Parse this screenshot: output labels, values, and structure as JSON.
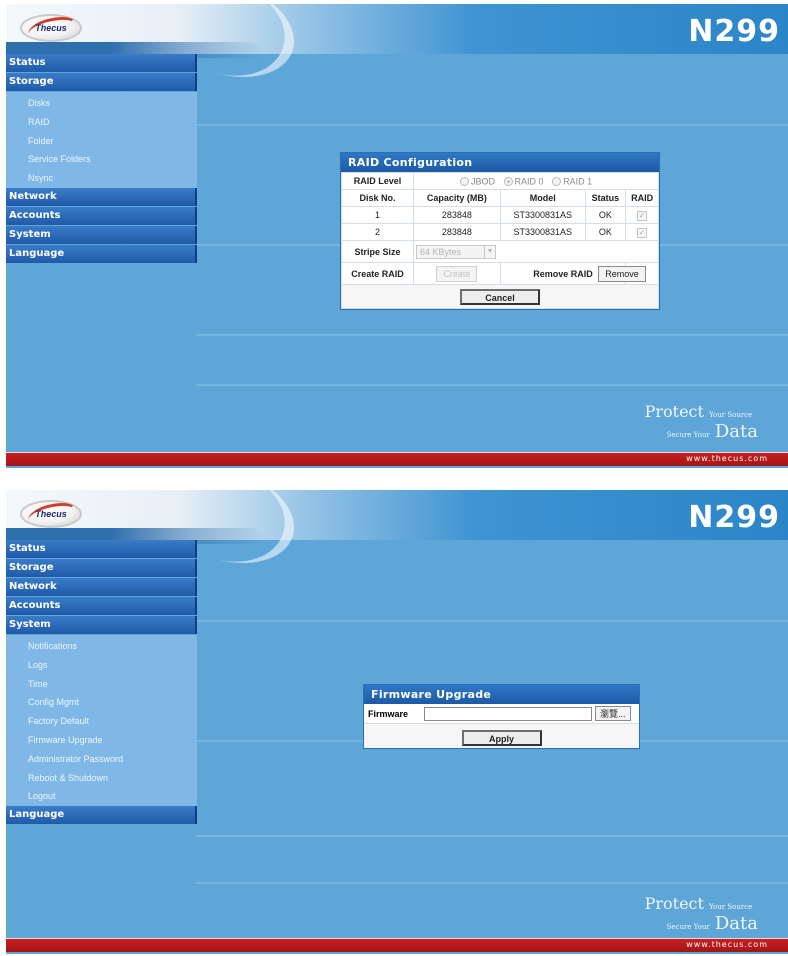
{
  "screens": [
    {
      "header": {
        "logo_text": "Thecus",
        "model": "N299"
      },
      "nav": {
        "status": "Status",
        "storage": "Storage",
        "storage_items": [
          "Disks",
          "RAID",
          "Folder",
          "Service Folders",
          "Nsync"
        ],
        "network": "Network",
        "accounts": "Accounts",
        "system": "System",
        "language": "Language"
      },
      "raid_panel": {
        "title": "RAID Configuration",
        "raid_level_label": "RAID Level",
        "options": [
          "JBOD",
          "RAID 0",
          "RAID 1"
        ],
        "selected_option": "RAID 0",
        "columns": [
          "Disk No.",
          "Capacity (MB)",
          "Model",
          "Status",
          "RAID"
        ],
        "rows": [
          {
            "disk": "1",
            "capacity": "283848",
            "model": "ST3300831AS",
            "status": "OK"
          },
          {
            "disk": "2",
            "capacity": "283848",
            "model": "ST3300831AS",
            "status": "OK"
          }
        ],
        "stripe_size_label": "Stripe Size",
        "stripe_size_value": "64 KBytes",
        "create_raid_label": "Create RAID",
        "create_button": "Create",
        "remove_raid_label": "Remove RAID",
        "remove_button": "Remove",
        "cancel_button": "Cancel"
      },
      "brand": {
        "protect": "Protect",
        "your_source": "Your Source",
        "secure_your": "Secure Your",
        "data": "Data"
      },
      "footer": "www.thecus.com"
    },
    {
      "header": {
        "logo_text": "Thecus",
        "model": "N299"
      },
      "nav": {
        "status": "Status",
        "storage": "Storage",
        "network": "Network",
        "accounts": "Accounts",
        "system": "System",
        "system_items": [
          "Notifications",
          "Logs",
          "Time",
          "Config Mgmt",
          "Factory Default",
          "Firmware Upgrade",
          "Administrator Password",
          "Reboot & Shutdown",
          "Logout"
        ],
        "language": "Language"
      },
      "firmware_panel": {
        "title": "Firmware Upgrade",
        "firmware_label": "Firmware",
        "firmware_value": "",
        "browse_button": "瀏覽...",
        "apply_button": "Apply"
      },
      "brand": {
        "protect": "Protect",
        "your_source": "Your Source",
        "secure_your": "Secure Your",
        "data": "Data"
      },
      "footer": "www.thecus.com"
    }
  ]
}
